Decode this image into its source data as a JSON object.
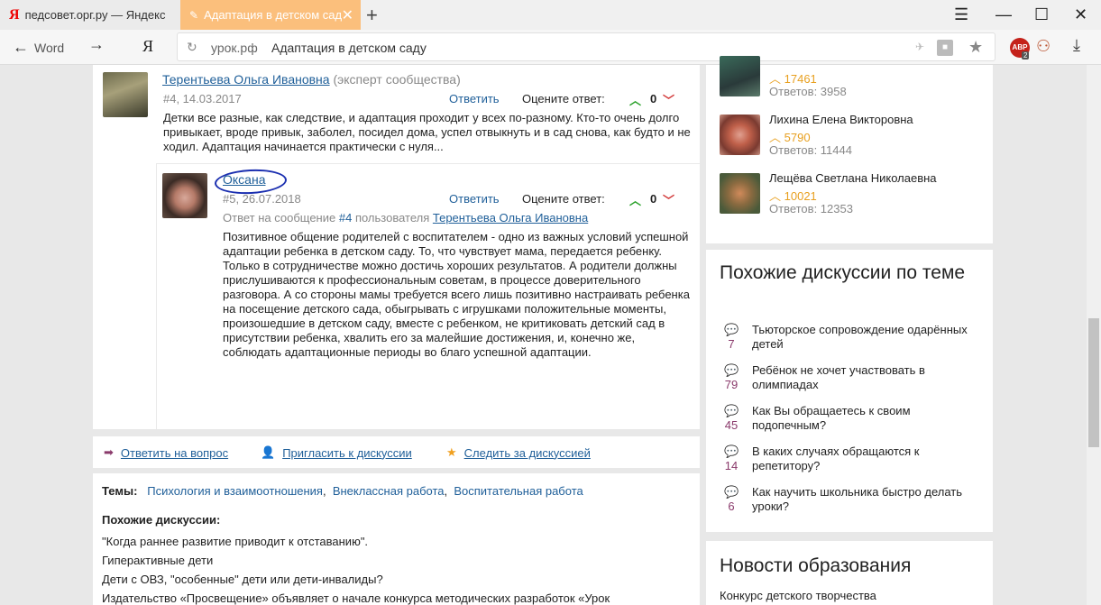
{
  "browser": {
    "tabs": [
      {
        "label": "педсовет.орг.ру — Яндекс",
        "logo": "Я"
      },
      {
        "label": "Адаптация в детском сад"
      }
    ],
    "back_label": "Word",
    "yandex_logo": "Я",
    "url_host": "урок.рф",
    "url_title": "Адаптация в детском саду",
    "adblock_label": "ABP",
    "adblock_count": "2"
  },
  "comments": [
    {
      "author": "Терентьева Ольга Ивановна",
      "badge": "(эксперт сообщества)",
      "meta": "#4, 14.03.2017",
      "reply": "Ответить",
      "rate_label": "Оцените ответ:",
      "votes": "0",
      "text": "Детки все разные, как следствие, и адаптация проходит у всех по-разному. Кто-то очень долго привыкает, вроде привык, заболел, посидел дома, успел отвыкнуть и в сад снова, как будто и не ходил. Адаптация начинается практически с нуля..."
    },
    {
      "author": "Оксана",
      "meta": "#5, 26.07.2018",
      "reply": "Ответить",
      "rate_label": "Оцените ответ:",
      "votes": "0",
      "reply_to_prefix": "Ответ на сообщение",
      "reply_to_num": "#4",
      "reply_to_mid": "пользователя",
      "reply_to_user": "Терентьева Ольга Ивановна",
      "text": "Позитивное общение родителей с воспитателем - одно из важных условий успешной адаптации ребенка в детском саду. То, что чувствует мама, передается ребенку. Только в сотрудничестве можно достичь хороших результатов. А родители должны прислушиваются к профессиональным советам, в процессе доверительного разговора. А со стороны мамы требуется всего лишь позитивно настраивать ребенка на посещение детского сада, обыгрывать с игрушками положительные моменты, произошедшие в детском саду, вместе с ребенком, не критиковать детский сад в присутствии ребенка, хвалить его за малейшие достижения, и, конечно же, соблюдать адаптационные периоды во благо успешной адаптации."
    }
  ],
  "actions": {
    "answer": "Ответить на вопрос",
    "invite": "Пригласить к дискуссии",
    "follow": "Следить за дискуссией"
  },
  "themes": {
    "label": "Темы:",
    "items": [
      "Психология и взаимоотношения",
      "Внеклассная работа",
      "Воспитательная работа"
    ],
    "similar_label": "Похожие дискуссии:",
    "similar": [
      "\"Когда раннее развитие приводит к отставанию\".",
      "Гиперактивные дети",
      "Дети с ОВЗ, \"особенные\" дети или дети-инвалиды?",
      "Издательство «Просвещение» объявляет о начале конкурса методических разработок «Урок"
    ]
  },
  "top_users": [
    {
      "name": "",
      "score": "17461",
      "answers": "Ответов: 3958"
    },
    {
      "name": "Лихина Елена Викторовна",
      "score": "5790",
      "answers": "Ответов: 11444"
    },
    {
      "name": "Лещёва Светлана Николаевна",
      "score": "10021",
      "answers": "Ответов: 12353"
    }
  ],
  "similar_sidebar": {
    "title": "Похожие дискуссии по теме",
    "items": [
      {
        "count": "7",
        "text": "Тьюторское сопровождение одарённых детей"
      },
      {
        "count": "79",
        "text": "Ребёнок не хочет участвовать в олимпиадах"
      },
      {
        "count": "45",
        "text": "Как Вы обращаетесь к своим подопечным?"
      },
      {
        "count": "14",
        "text": "В каких случаях обращаются к репетитору?"
      },
      {
        "count": "6",
        "text": "Как научить школьника быстро делать уроки?"
      }
    ]
  },
  "news": {
    "title": "Новости образования",
    "first": "Конкурс детского творчества"
  }
}
